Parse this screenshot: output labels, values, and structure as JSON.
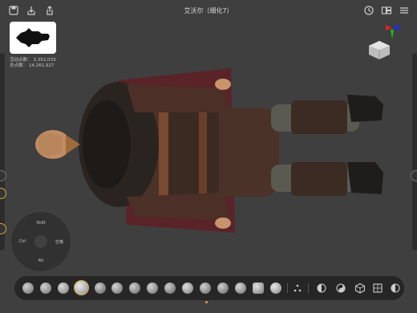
{
  "window": {
    "title": "艾沃尔（细化7）"
  },
  "stats": {
    "active_label": "活动点数：",
    "active_value": "3,352,033",
    "total_label": "总点数：",
    "total_value": "14,261,927"
  },
  "joystick": {
    "top": "Shift",
    "left": "Ctrl",
    "right": "空格",
    "bottom": "Alt"
  },
  "colors": {
    "accent": "#d6a544",
    "background": "#3f3f3f",
    "dock": "#262626"
  },
  "icons": {
    "top_left": [
      "save-icon",
      "import-icon",
      "share-icon"
    ],
    "top_right": [
      "history-icon",
      "layout-icon",
      "menu-icon"
    ],
    "tools": [
      "transpose-icon",
      "mask-icon",
      "polygroup-icon",
      "hide-icon",
      "frame-icon",
      "symmetry-icon"
    ]
  }
}
